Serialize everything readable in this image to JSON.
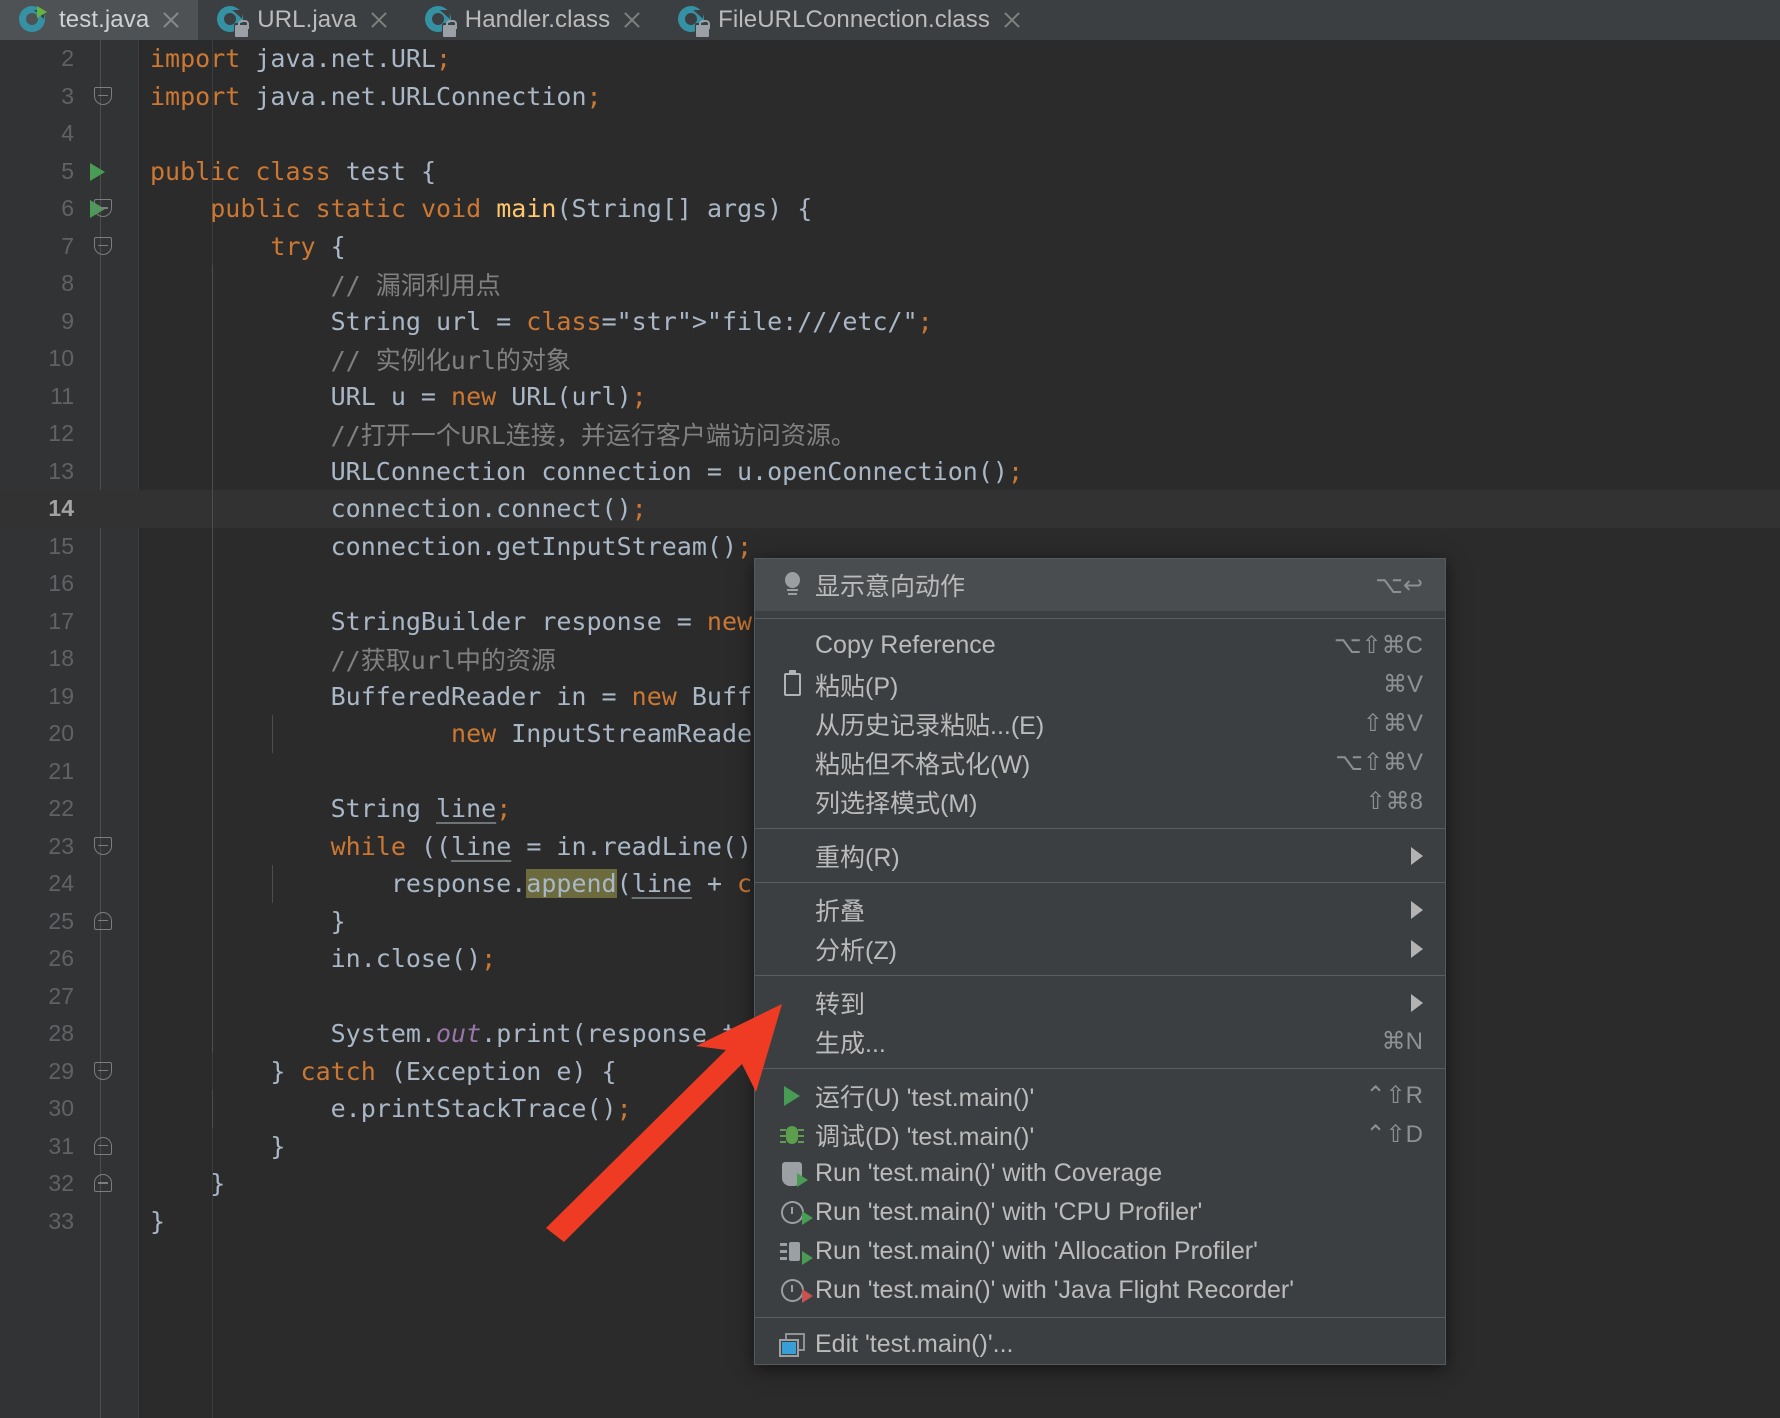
{
  "tabs": [
    {
      "label": "test.java",
      "icon": "java-class-run-icon",
      "active": true,
      "locked": false
    },
    {
      "label": "URL.java",
      "icon": "java-class-locked-icon",
      "active": false,
      "locked": true
    },
    {
      "label": "Handler.class",
      "icon": "java-class-locked-icon",
      "active": false,
      "locked": true
    },
    {
      "label": "FileURLConnection.class",
      "icon": "java-class-locked-icon",
      "active": false,
      "locked": true
    }
  ],
  "editor": {
    "current_line": 14,
    "first_visible_line": 2,
    "last_visible_line": 33,
    "lines": [
      {
        "n": "2",
        "text": "import java.net.URL;"
      },
      {
        "n": "3",
        "text": "import java.net.URLConnection;"
      },
      {
        "n": "4",
        "text": ""
      },
      {
        "n": "5",
        "text": "public class test {"
      },
      {
        "n": "6",
        "text": "    public static void main(String[] args) {"
      },
      {
        "n": "7",
        "text": "        try {"
      },
      {
        "n": "8",
        "text": "            // 漏洞利用点"
      },
      {
        "n": "9",
        "text": "            String url = \"file:///etc/\";"
      },
      {
        "n": "10",
        "text": "            // 实例化url的对象"
      },
      {
        "n": "11",
        "text": "            URL u = new URL(url);"
      },
      {
        "n": "12",
        "text": "            //打开一个URL连接，并运行客户端访问资源。"
      },
      {
        "n": "13",
        "text": "            URLConnection connection = u.openConnection();"
      },
      {
        "n": "14",
        "text": "            connection.connect();"
      },
      {
        "n": "15",
        "text": "            connection.getInputStream();"
      },
      {
        "n": "16",
        "text": ""
      },
      {
        "n": "17",
        "text": "            StringBuilder response = new"
      },
      {
        "n": "18",
        "text": "            //获取url中的资源"
      },
      {
        "n": "19",
        "text": "            BufferedReader in = new Buff"
      },
      {
        "n": "20",
        "text": "                    new InputStreamReade"
      },
      {
        "n": "21",
        "text": ""
      },
      {
        "n": "22",
        "text": "            String line;"
      },
      {
        "n": "23",
        "text": "            while ((line = in.readLine()"
      },
      {
        "n": "24",
        "text": "                response.append(line + \""
      },
      {
        "n": "25",
        "text": "            }"
      },
      {
        "n": "26",
        "text": "            in.close();"
      },
      {
        "n": "27",
        "text": ""
      },
      {
        "n": "28",
        "text": "            System.out.print(response.to"
      },
      {
        "n": "29",
        "text": "        } catch (Exception e) {"
      },
      {
        "n": "30",
        "text": "            e.printStackTrace();"
      },
      {
        "n": "31",
        "text": "        }"
      },
      {
        "n": "32",
        "text": "    }"
      },
      {
        "n": "33",
        "text": "}"
      }
    ]
  },
  "context_menu": {
    "groups": [
      {
        "header": true,
        "items": [
          {
            "label": "显示意向动作",
            "shortcut": "⌥↩",
            "icon": "lightbulb-icon",
            "submenu": false
          }
        ]
      },
      {
        "header": false,
        "items": [
          {
            "label": "Copy Reference",
            "shortcut": "⌥⇧⌘C",
            "icon": "",
            "submenu": false
          },
          {
            "label": "粘贴(P)",
            "shortcut": "⌘V",
            "icon": "clipboard-icon",
            "submenu": false
          },
          {
            "label": "从历史记录粘贴...(E)",
            "shortcut": "⇧⌘V",
            "icon": "",
            "submenu": false
          },
          {
            "label": "粘贴但不格式化(W)",
            "shortcut": "⌥⇧⌘V",
            "icon": "",
            "submenu": false
          },
          {
            "label": "列选择模式(M)",
            "shortcut": "⇧⌘8",
            "icon": "",
            "submenu": false
          }
        ]
      },
      {
        "header": false,
        "items": [
          {
            "label": "重构(R)",
            "shortcut": "",
            "icon": "",
            "submenu": true
          }
        ]
      },
      {
        "header": false,
        "items": [
          {
            "label": "折叠",
            "shortcut": "",
            "icon": "",
            "submenu": true
          },
          {
            "label": "分析(Z)",
            "shortcut": "",
            "icon": "",
            "submenu": true
          }
        ]
      },
      {
        "header": false,
        "items": [
          {
            "label": "转到",
            "shortcut": "",
            "icon": "",
            "submenu": true
          },
          {
            "label": "生成...",
            "shortcut": "⌘N",
            "icon": "",
            "submenu": false
          }
        ]
      },
      {
        "header": false,
        "items": [
          {
            "label": "运行(U) 'test.main()'",
            "shortcut": "⌃⇧R",
            "icon": "run-play-icon",
            "submenu": false
          },
          {
            "label": "调试(D) 'test.main()'",
            "shortcut": "⌃⇧D",
            "icon": "debug-bug-icon",
            "submenu": false
          },
          {
            "label": "Run 'test.main()' with Coverage",
            "shortcut": "",
            "icon": "coverage-shield-icon",
            "submenu": false
          },
          {
            "label": "Run 'test.main()' with 'CPU Profiler'",
            "shortcut": "",
            "icon": "cpu-profiler-icon",
            "submenu": false
          },
          {
            "label": "Run 'test.main()' with 'Allocation Profiler'",
            "shortcut": "",
            "icon": "allocation-profiler-icon",
            "submenu": false
          },
          {
            "label": "Run 'test.main()' with 'Java Flight Recorder'",
            "shortcut": "",
            "icon": "flight-recorder-icon",
            "submenu": false
          }
        ]
      },
      {
        "header": false,
        "items": [
          {
            "label": "Edit 'test.main()'...",
            "shortcut": "",
            "icon": "edit-config-icon",
            "submenu": false
          }
        ]
      }
    ]
  },
  "annotation": {
    "arrow_color": "#ef3b23",
    "points_to": "调试(D) 'test.main()'"
  },
  "colors": {
    "editor_bg": "#2b2b2b",
    "gutter_bg": "#313335",
    "menu_bg": "#3c3f41",
    "tab_active_bg": "#4e5254",
    "keyword": "#cc7832",
    "string": "#6a8759",
    "comment": "#808080",
    "text": "#a9b7c6",
    "method": "#ffc66d",
    "field": "#9876aa",
    "run_green": "#499c54"
  }
}
